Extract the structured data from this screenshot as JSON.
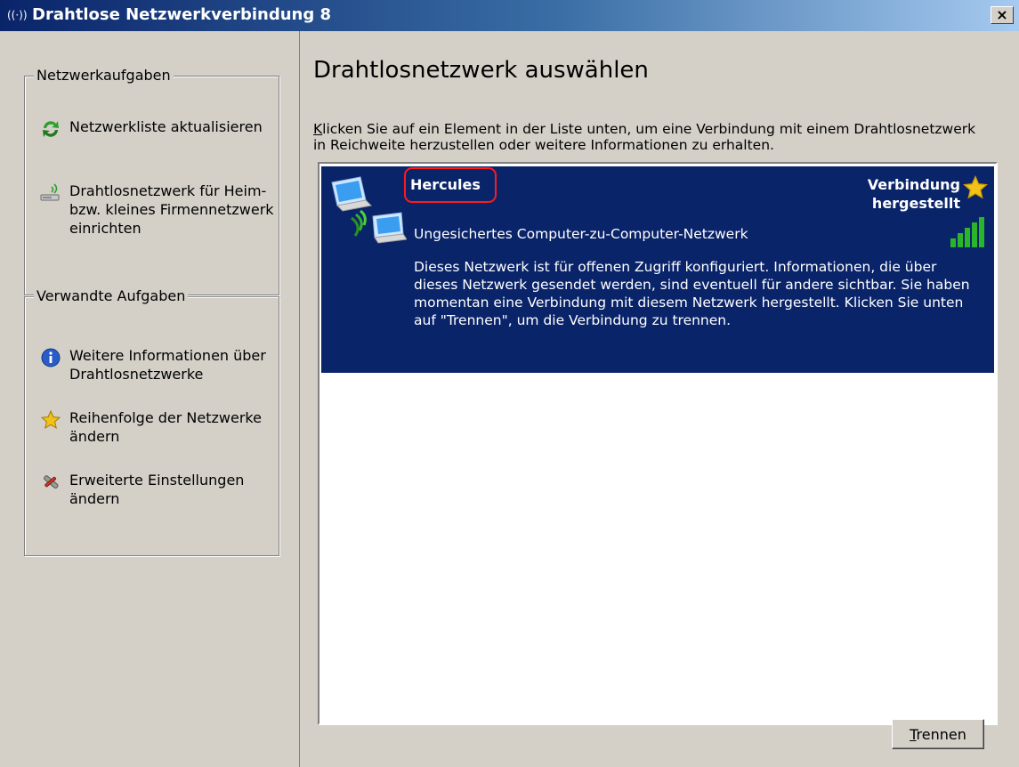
{
  "window": {
    "title": "Drahtlose Netzwerkverbindung 8",
    "icon": "wireless-network-icon",
    "close_label": "×"
  },
  "sidebar": {
    "network_tasks": {
      "legend": "Netzwerkaufgaben",
      "items": [
        {
          "icon": "refresh-icon",
          "label": "Netzwerkliste aktualisieren"
        },
        {
          "icon": "wireless-setup-icon",
          "label": "Drahtlosnetzwerk für Heim- bzw. kleines Firmennetzwerk einrichten"
        }
      ]
    },
    "related_tasks": {
      "legend": "Verwandte Aufgaben",
      "items": [
        {
          "icon": "info-icon",
          "label": "Weitere Informationen über Drahtlosnetzwerke"
        },
        {
          "icon": "star-icon",
          "label": "Reihenfolge der Netzwerke ändern"
        },
        {
          "icon": "settings-tools-icon",
          "label": "Erweiterte Einstellungen ändern"
        }
      ]
    }
  },
  "main": {
    "heading": "Drahtlosnetzwerk auswählen",
    "instructions_first_char": "K",
    "instructions_rest": "licken Sie auf ein Element in der Liste unten, um eine Verbindung mit einem Drahtlosnetzwerk in Reichweite herzustellen oder weitere Informationen zu erhalten.",
    "networks": [
      {
        "ssid": "Hercules",
        "status_line1": "Verbindung",
        "status_line2": "hergestellt",
        "security": "Ungesichertes Computer-zu-Computer-Netzwerk",
        "description": "Dieses Netzwerk ist für offenen Zugriff konfiguriert. Informationen, die über dieses Netzwerk gesendet werden, sind eventuell für andere sichtbar. Sie haben momentan eine Verbindung mit diesem Netzwerk hergestellt. Klicken Sie unten auf \"Trennen\", um die Verbindung zu trennen.",
        "signal_bars": 5,
        "selected": true
      }
    ],
    "disconnect_button": {
      "accel": "T",
      "rest": "rennen"
    }
  },
  "colors": {
    "selection_bg": "#0a246a",
    "window_bg": "#d4d0c8",
    "highlight_mark": "#ff1a1a",
    "signal_green": "#2bb52b"
  }
}
